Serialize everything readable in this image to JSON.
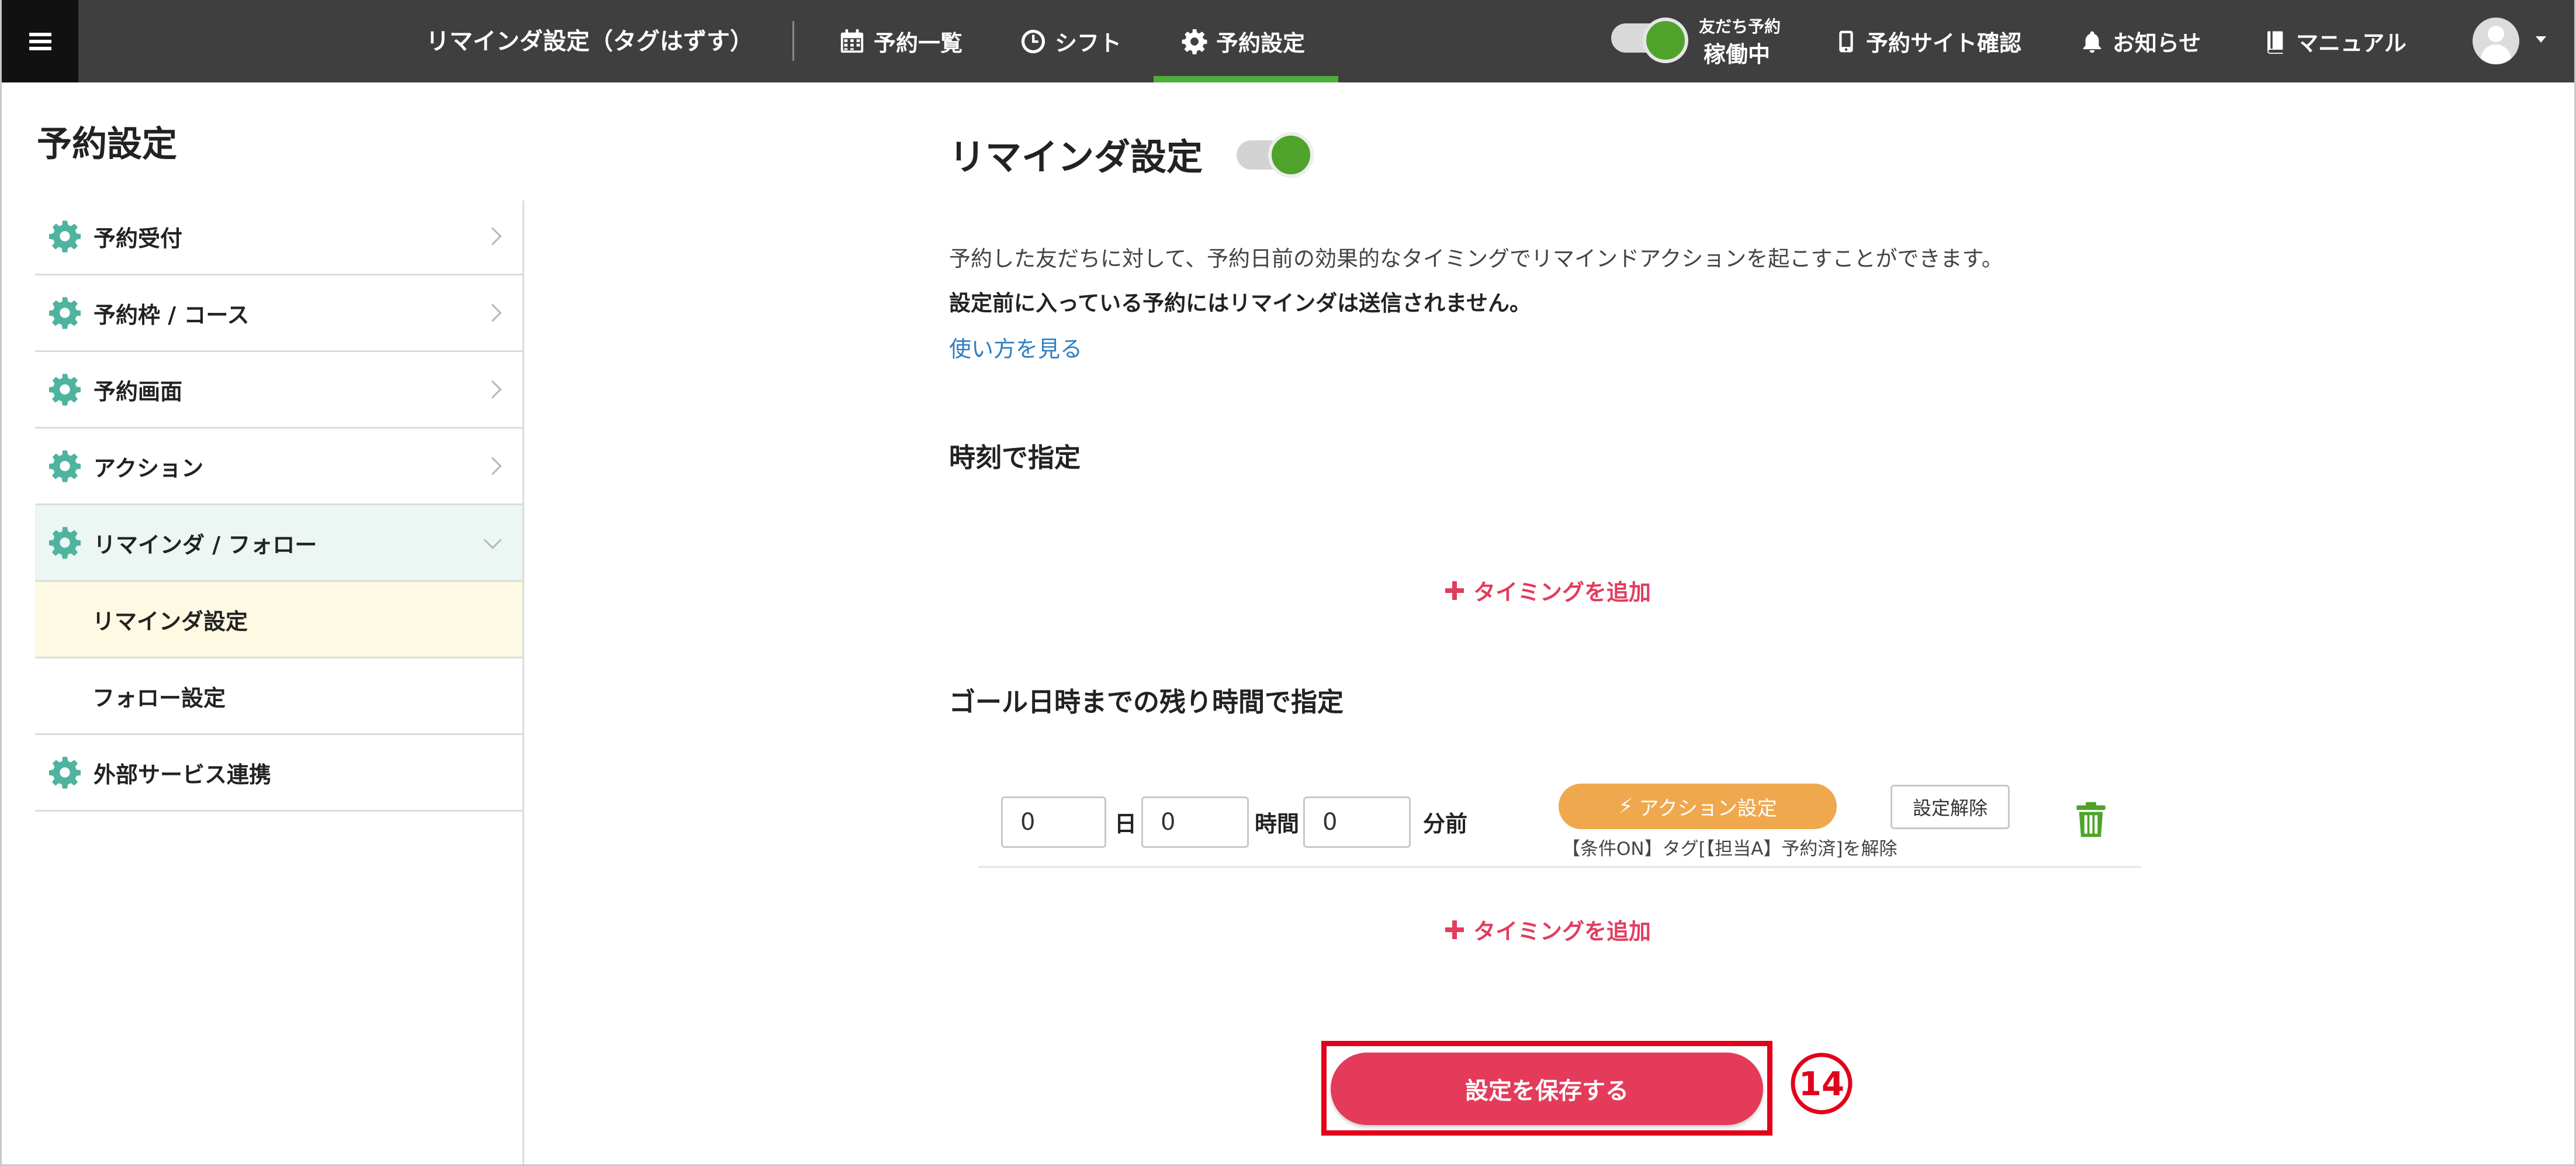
{
  "header": {
    "page_crumb": "リマインダ設定（タグはずす）",
    "nav": [
      {
        "label": "予約一覧",
        "icon": "calendar-icon"
      },
      {
        "label": "シフト",
        "icon": "clock-icon"
      },
      {
        "label": "予約設定",
        "icon": "gear-icon",
        "active": true
      }
    ],
    "status_small": "友だち予約",
    "status_big": "稼働中",
    "site_check": "予約サイト確認",
    "notice": "お知らせ",
    "manual": "マニュアル"
  },
  "sidebar": {
    "title": "予約設定",
    "items": [
      {
        "label": "予約受付"
      },
      {
        "label": "予約枠 / コース"
      },
      {
        "label": "予約画面"
      },
      {
        "label": "アクション"
      },
      {
        "label": "リマインダ / フォロー",
        "expanded": true
      },
      {
        "label": "外部サービス連携"
      }
    ],
    "subitems": [
      {
        "label": "リマインダ設定",
        "active": true
      },
      {
        "label": "フォロー設定"
      }
    ]
  },
  "main": {
    "title": "リマインダ設定",
    "desc1": "予約した友だちに対して、予約日前の効果的なタイミングでリマインドアクションを起こすことができます。",
    "desc2": "設定前に入っている予約にはリマインダは送信されません。",
    "howto_link": "使い方を見る",
    "section_time": "時刻で指定",
    "add_timing": "タイミングを追加",
    "section_goal": "ゴール日時までの残り時間で指定",
    "row": {
      "days": "0",
      "days_unit": "日",
      "hours": "0",
      "hours_unit": "時間",
      "minutes": "0",
      "minutes_unit": "分前",
      "action_label": "アクション設定",
      "unset_label": "設定解除",
      "condition": "【条件ON】タグ[【担当A】予約済]を解除"
    },
    "save_label": "設定を保存する",
    "step_marker": "⑭"
  },
  "colors": {
    "topbar": "#3f3f3f",
    "accent_green": "#4fa32b",
    "gear_teal": "#4fb39f",
    "pink": "#e23c5e",
    "orange": "#f0a84e",
    "highlight_red": "#e2001a"
  }
}
